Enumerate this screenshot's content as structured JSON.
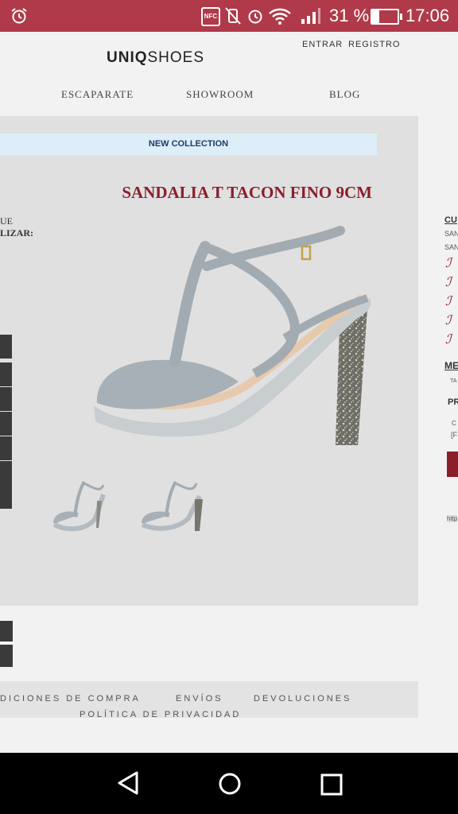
{
  "status": {
    "nfc": "NFC",
    "battery": "31 %",
    "time": "17:06"
  },
  "header": {
    "entrar": "ENTRAR",
    "registro": "REGISTRO",
    "logo_bold": "UNIQ",
    "logo_light": "SHOES"
  },
  "nav": [
    "ESCAPARATE",
    "SHOWROOM",
    "BLOG"
  ],
  "product": {
    "banner": "NEW COLLECTION",
    "title": "SANDALIA T TACON FINO 9CM",
    "side_label_1": "UE",
    "side_label_2": "LIZAR:"
  },
  "right_col": {
    "heading": "CU",
    "line1": "SAN",
    "line2": "SAN",
    "me": "ME",
    "ta": "TA",
    "pr": "PR",
    "c": "C",
    "bracket": "[F",
    "http": "http"
  },
  "footer": {
    "link1": "DICIONES DE COMPRA",
    "link2": "ENVÍOS",
    "link3": "DEVOLUCIONES",
    "link4": "POLÍTICA DE PRIVACIDAD"
  },
  "colors": {
    "status_bar": "#b03a4a",
    "title_red": "#8a1f2a",
    "banner_bg": "#ddeef8",
    "banner_text": "#1b3d66"
  }
}
